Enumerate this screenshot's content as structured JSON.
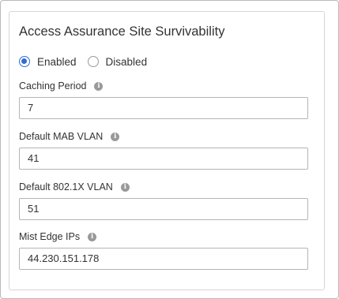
{
  "panel": {
    "title": "Access Assurance Site Survivability"
  },
  "mode": {
    "options": [
      {
        "label": "Enabled",
        "checked": true
      },
      {
        "label": "Disabled",
        "checked": false
      }
    ]
  },
  "fields": {
    "caching_period": {
      "label": "Caching Period",
      "value": "7"
    },
    "default_mab_vlan": {
      "label": "Default MAB VLAN",
      "value": "41"
    },
    "default_8021x_vlan": {
      "label": "Default 802.1X VLAN",
      "value": "51"
    },
    "mist_edge_ips": {
      "label": "Mist Edge IPs",
      "value": "44.230.151.178"
    }
  },
  "icons": {
    "info": "info-icon",
    "info_glyph": "i"
  },
  "colors": {
    "accent": "#2e6bd6",
    "border": "#b5b5b5",
    "icon_gray": "#999999"
  }
}
